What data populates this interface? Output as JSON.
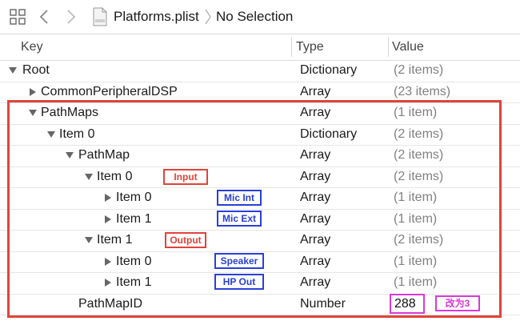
{
  "breadcrumb": {
    "file": "Platforms.plist",
    "selection": "No Selection"
  },
  "columns": {
    "key": "Key",
    "type": "Type",
    "value": "Value"
  },
  "rows": [
    {
      "key": "Root",
      "type": "Dictionary",
      "value": "(2 items)",
      "expanded": true
    },
    {
      "key": "CommonPeripheralDSP",
      "type": "Array",
      "value": "(23 items)",
      "expanded": false
    },
    {
      "key": "PathMaps",
      "type": "Array",
      "value": "(1 item)",
      "expanded": true
    },
    {
      "key": "Item 0",
      "type": "Dictionary",
      "value": "(2 items)",
      "expanded": true
    },
    {
      "key": "PathMap",
      "type": "Array",
      "value": "(2 items)",
      "expanded": true
    },
    {
      "key": "Item 0",
      "type": "Array",
      "value": "(2 items)",
      "expanded": true
    },
    {
      "key": "Item 0",
      "type": "Array",
      "value": "(1 item)",
      "expanded": false
    },
    {
      "key": "Item 1",
      "type": "Array",
      "value": "(1 item)",
      "expanded": false
    },
    {
      "key": "Item 1",
      "type": "Array",
      "value": "(2 items)",
      "expanded": true
    },
    {
      "key": "Item 0",
      "type": "Array",
      "value": "(1 item)",
      "expanded": false
    },
    {
      "key": "Item 1",
      "type": "Array",
      "value": "(1 item)",
      "expanded": false
    },
    {
      "key": "PathMapID",
      "type": "Number",
      "value": "288"
    }
  ],
  "annotations": {
    "input": "Input",
    "mic_int": "Mic Int",
    "mic_ext": "Mic Ext",
    "output": "Output",
    "speaker": "Speaker",
    "hp_out": "HP Out",
    "change_to": "改为3"
  },
  "colors": {
    "annotation_red": "#e0443a",
    "annotation_blue": "#2a3fd6",
    "annotation_magenta": "#d63ad6"
  }
}
